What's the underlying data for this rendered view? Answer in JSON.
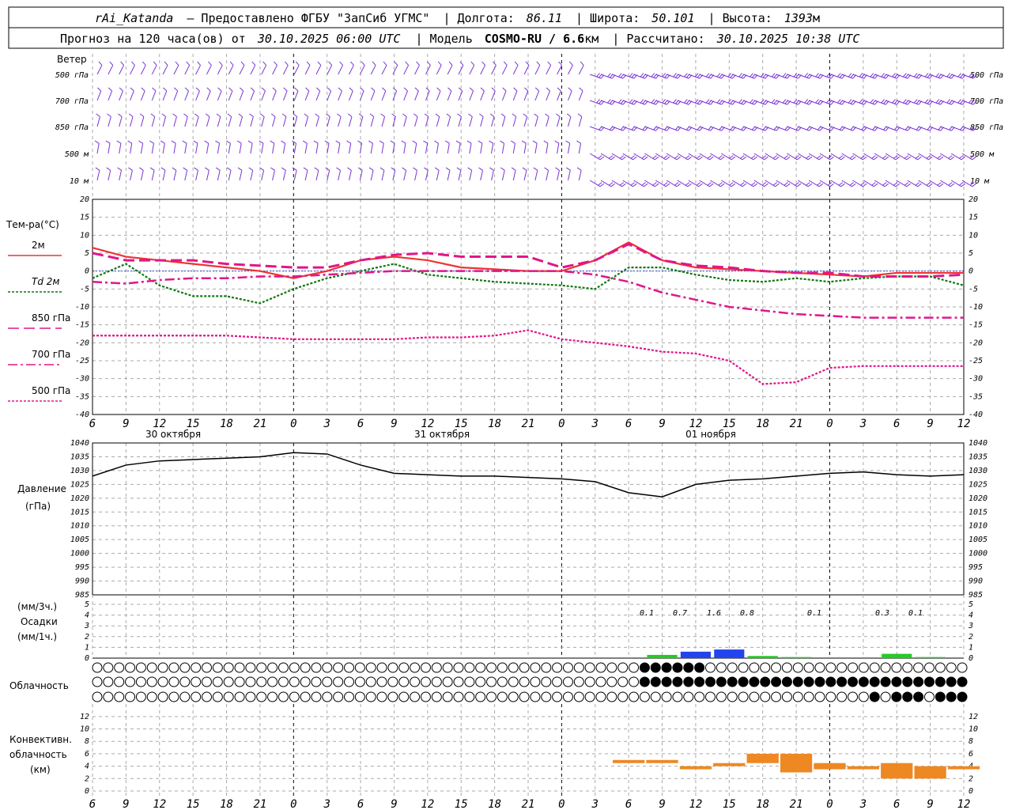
{
  "header": {
    "station": "rAi_Katanda",
    "provider": "— Предоставлено ФГБУ \"ЗапСиб УГМС\"",
    "lon_label": "| Долгота:",
    "lon_value": "86.11",
    "lat_label": "| Широта:",
    "lat_value": "50.101",
    "alt_label": "| Высота:",
    "alt_value": "1393",
    "alt_unit": "м",
    "forecast_prefix": "Прогноз на 120 часа(ов) от",
    "forecast_from": "30.10.2025 06:00 UTC",
    "model_label": "| Модель",
    "model_name": "COSMO-RU / 6.6",
    "model_unit": "км",
    "calc_label": "| Рассчитано:",
    "calc_time": "30.10.2025 10:38 UTC"
  },
  "wind_panel": {
    "title": "Ветер",
    "levels": [
      "500 гПа",
      "700 гПа",
      "850 гПа",
      "500 м",
      "10 м"
    ]
  },
  "colors": {
    "wind": "#7a32d6",
    "t2m": "#ee3333",
    "td": "#117711",
    "t850": "#e0168a",
    "t700": "#e0168a",
    "t500": "#e0168a",
    "pressure": "#000000",
    "precip_green": "#22cc22",
    "precip_blue": "#2244ee",
    "conv": "#ee8822"
  },
  "x_axis": {
    "ticks": [
      "6",
      "9",
      "12",
      "15",
      "18",
      "21",
      "0",
      "3",
      "6",
      "9",
      "12",
      "15",
      "18",
      "21",
      "0",
      "3",
      "6",
      "9",
      "12",
      "15",
      "18",
      "21",
      "0",
      "3",
      "6",
      "9",
      "12"
    ],
    "dates": [
      "30 октября",
      "31 октября",
      "01 ноября"
    ]
  },
  "temp_panel": {
    "title": "Тем-ра(°С)",
    "legend": [
      {
        "label": "2м",
        "color": "#ee3333"
      },
      {
        "label": "Td  2м",
        "color": "#117711"
      },
      {
        "label": "850 гПа",
        "color": "#e0168a"
      },
      {
        "label": "700 гПа",
        "color": "#e0168a"
      },
      {
        "label": "500 гПа",
        "color": "#e0168a"
      }
    ],
    "y_ticks": [
      "20",
      "15",
      "10",
      "5",
      "0",
      "-5",
      "-10",
      "-15",
      "-20",
      "-25",
      "-30",
      "-35",
      "-40"
    ]
  },
  "pressure_panel": {
    "title1": "Давление",
    "title2": "(гПа)",
    "y_ticks": [
      "1040",
      "1035",
      "1030",
      "1025",
      "1020",
      "1015",
      "1010",
      "1005",
      "1000",
      "995",
      "990",
      "985"
    ]
  },
  "precip_panel": {
    "title1": "(мм/3ч.)",
    "title2": "Осадки",
    "title3": "(мм/1ч.)",
    "y_ticks": [
      "5",
      "4",
      "3",
      "2",
      "1",
      "0"
    ],
    "totals": [
      "0.1",
      "0.7",
      "1.6",
      "0.8",
      "0.1",
      "0.3",
      "0.1"
    ]
  },
  "cloud_panel": {
    "title": "Облачность"
  },
  "conv_panel": {
    "title1": "Конвективн.",
    "title2": "облачность",
    "title3": "(км)",
    "y_ticks": [
      "12",
      "10",
      "8",
      "6",
      "4",
      "2",
      "0"
    ]
  },
  "chart_data": [
    {
      "type": "line",
      "title": "Тем-ра(°С)",
      "x": [
        "6",
        "9",
        "12",
        "15",
        "18",
        "21",
        "0",
        "3",
        "6",
        "9",
        "12",
        "15",
        "18",
        "21",
        "0",
        "3",
        "6",
        "9",
        "12",
        "15",
        "18",
        "21",
        "0",
        "3",
        "6",
        "9",
        "12"
      ],
      "ylim": [
        -40,
        20
      ],
      "series": [
        {
          "name": "2м",
          "values": [
            6.5,
            4,
            3,
            2,
            1,
            0,
            -2,
            0,
            3,
            4,
            3,
            1,
            0.5,
            0,
            0,
            3,
            8,
            3,
            1,
            0.5,
            0,
            -0.5,
            -1,
            -1.5,
            -0.5,
            -0.5,
            -0.5
          ]
        },
        {
          "name": "Td  2м",
          "values": [
            -2,
            2,
            -4,
            -7,
            -7,
            -9,
            -5,
            -2,
            0,
            2,
            -1,
            -2,
            -3,
            -3.5,
            -4,
            -5,
            1,
            1,
            -1,
            -2.5,
            -3,
            -2,
            -3,
            -2,
            -1.5,
            -1.5,
            -4
          ]
        },
        {
          "name": "850 гПа",
          "values": [
            5,
            3,
            3,
            3,
            2,
            1.5,
            1,
            1,
            3,
            4.5,
            5,
            4,
            4,
            4,
            1,
            3,
            7.5,
            3,
            1.5,
            1,
            0,
            -0.5,
            -0.5,
            -1.5,
            -1.5,
            -1.5,
            -1
          ]
        },
        {
          "name": "700 гПа",
          "values": [
            -3,
            -3.5,
            -2.5,
            -2,
            -2,
            -1.5,
            -1.5,
            -1,
            -0.5,
            0,
            0,
            0,
            0,
            0,
            0,
            -1,
            -3,
            -6,
            -8,
            -10,
            -11,
            -12,
            -12.5,
            -13,
            -13,
            -13,
            -13
          ]
        },
        {
          "name": "500 гПа",
          "values": [
            -18,
            -18,
            -18,
            -18,
            -18,
            -18.5,
            -19,
            -19,
            -19,
            -19,
            -18.5,
            -18.5,
            -18,
            -16.5,
            -19,
            -20,
            -21,
            -22.5,
            -23,
            -25,
            -31.5,
            -31,
            -27,
            -26.5,
            -26.5,
            -26.5,
            -26.5
          ]
        }
      ]
    },
    {
      "type": "line",
      "title": "Давление",
      "x": [
        "6",
        "9",
        "12",
        "15",
        "18",
        "21",
        "0",
        "3",
        "6",
        "9",
        "12",
        "15",
        "18",
        "21",
        "0",
        "3",
        "6",
        "9",
        "12",
        "15",
        "18",
        "21",
        "0",
        "3",
        "6",
        "9",
        "12"
      ],
      "ylim": [
        985,
        1040
      ],
      "series": [
        {
          "name": "Давление",
          "values": [
            1028,
            1032,
            1033.5,
            1034,
            1034.5,
            1035,
            1036.5,
            1036,
            1032,
            1029,
            1028.5,
            1028,
            1028,
            1027.5,
            1027,
            1026,
            1022,
            1020.5,
            1025,
            1026.5,
            1027,
            1028,
            1029,
            1029.5,
            1028.5,
            1028,
            1028.5
          ]
        }
      ]
    },
    {
      "type": "bar",
      "title": "Осадки",
      "x": [
        "6",
        "9",
        "12",
        "15",
        "18",
        "21",
        "0",
        "3",
        "6",
        "9",
        "12",
        "15",
        "18",
        "21",
        "0",
        "3",
        "6",
        "9",
        "12",
        "15",
        "18",
        "21",
        "0",
        "3",
        "6",
        "9",
        "12"
      ],
      "ylim": [
        0,
        5
      ],
      "series": [
        {
          "name": "мм/1ч",
          "values": [
            0,
            0,
            0,
            0,
            0,
            0,
            0,
            0,
            0,
            0,
            0,
            0,
            0,
            0,
            0,
            0,
            0,
            0.3,
            0.6,
            0.8,
            0.2,
            0.1,
            0,
            0,
            0.4,
            0.1,
            0
          ]
        }
      ]
    },
    {
      "type": "bar",
      "title": "Конвективн. облачность (км)",
      "x": [
        "6",
        "9",
        "12",
        "15",
        "18",
        "21",
        "0",
        "3",
        "6",
        "9",
        "12",
        "15",
        "18",
        "21",
        "0",
        "3",
        "6",
        "9",
        "12",
        "15",
        "18",
        "21",
        "0",
        "3",
        "6",
        "9",
        "12"
      ],
      "ylim": [
        0,
        13
      ],
      "series": [
        {
          "name": "нижняя граница",
          "values": [
            0,
            0,
            0,
            0,
            0,
            0,
            0,
            0,
            0,
            0,
            0,
            0,
            0,
            0,
            0,
            0,
            4.5,
            4.5,
            3.5,
            4,
            4.5,
            3,
            3.5,
            3.5,
            2,
            2,
            3.5
          ]
        },
        {
          "name": "верхняя граница",
          "values": [
            0,
            0,
            0,
            0,
            0,
            0,
            0,
            0,
            0,
            0,
            0,
            0,
            0,
            0,
            0,
            0,
            5,
            5,
            4,
            4.5,
            6,
            6,
            4.5,
            4,
            4.5,
            4,
            4
          ]
        }
      ]
    }
  ]
}
